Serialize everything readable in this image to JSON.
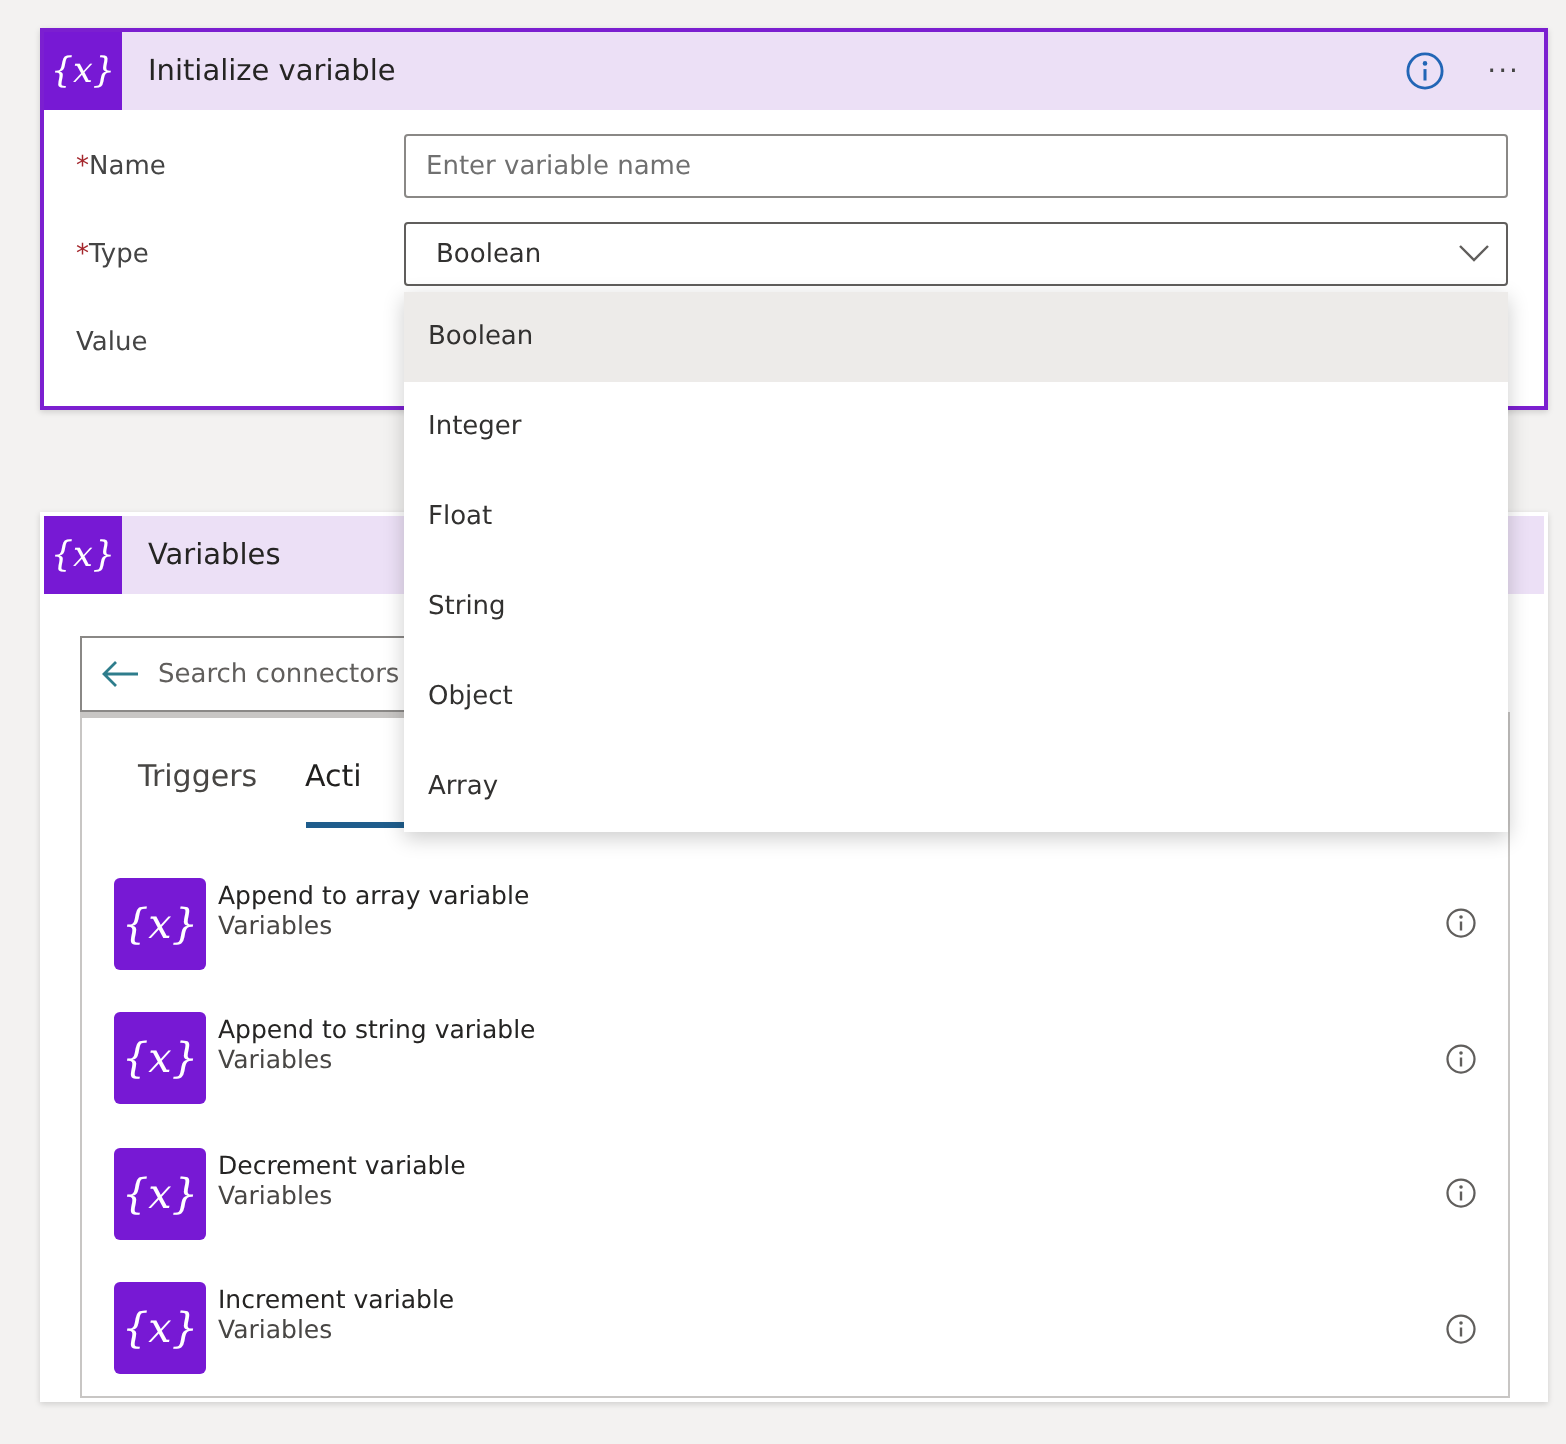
{
  "init_card": {
    "icon": "{x}",
    "title": "Initialize variable",
    "more": "···",
    "fields": [
      {
        "kind": "input",
        "label": "Name",
        "required_mark": "*",
        "placeholder": "Enter variable name"
      },
      {
        "kind": "select",
        "label": "Type",
        "required_mark": "*",
        "value": "Boolean",
        "expanded": true
      },
      {
        "kind": "empty",
        "label": "Value"
      }
    ]
  },
  "type_dropdown": {
    "options": [
      {
        "label": "Boolean",
        "selected": true
      },
      {
        "label": "Integer",
        "selected": false
      },
      {
        "label": "Float",
        "selected": false
      },
      {
        "label": "String",
        "selected": false
      },
      {
        "label": "Object",
        "selected": false
      },
      {
        "label": "Array",
        "selected": false
      }
    ]
  },
  "variables_card": {
    "icon": "{x}",
    "title": "Variables",
    "search": {
      "placeholder": "Search connectors"
    },
    "tabs": [
      {
        "label": "Triggers",
        "selected": false
      },
      {
        "label": "Acti",
        "selected": true
      }
    ],
    "actions": [
      {
        "icon": "{x}",
        "title": "Append to array variable",
        "connector": "Variables"
      },
      {
        "icon": "{x}",
        "title": "Append to string variable",
        "connector": "Variables"
      },
      {
        "icon": "{x}",
        "title": "Decrement variable",
        "connector": "Variables"
      },
      {
        "icon": "{x}",
        "title": "Increment variable",
        "connector": "Variables"
      }
    ]
  }
}
